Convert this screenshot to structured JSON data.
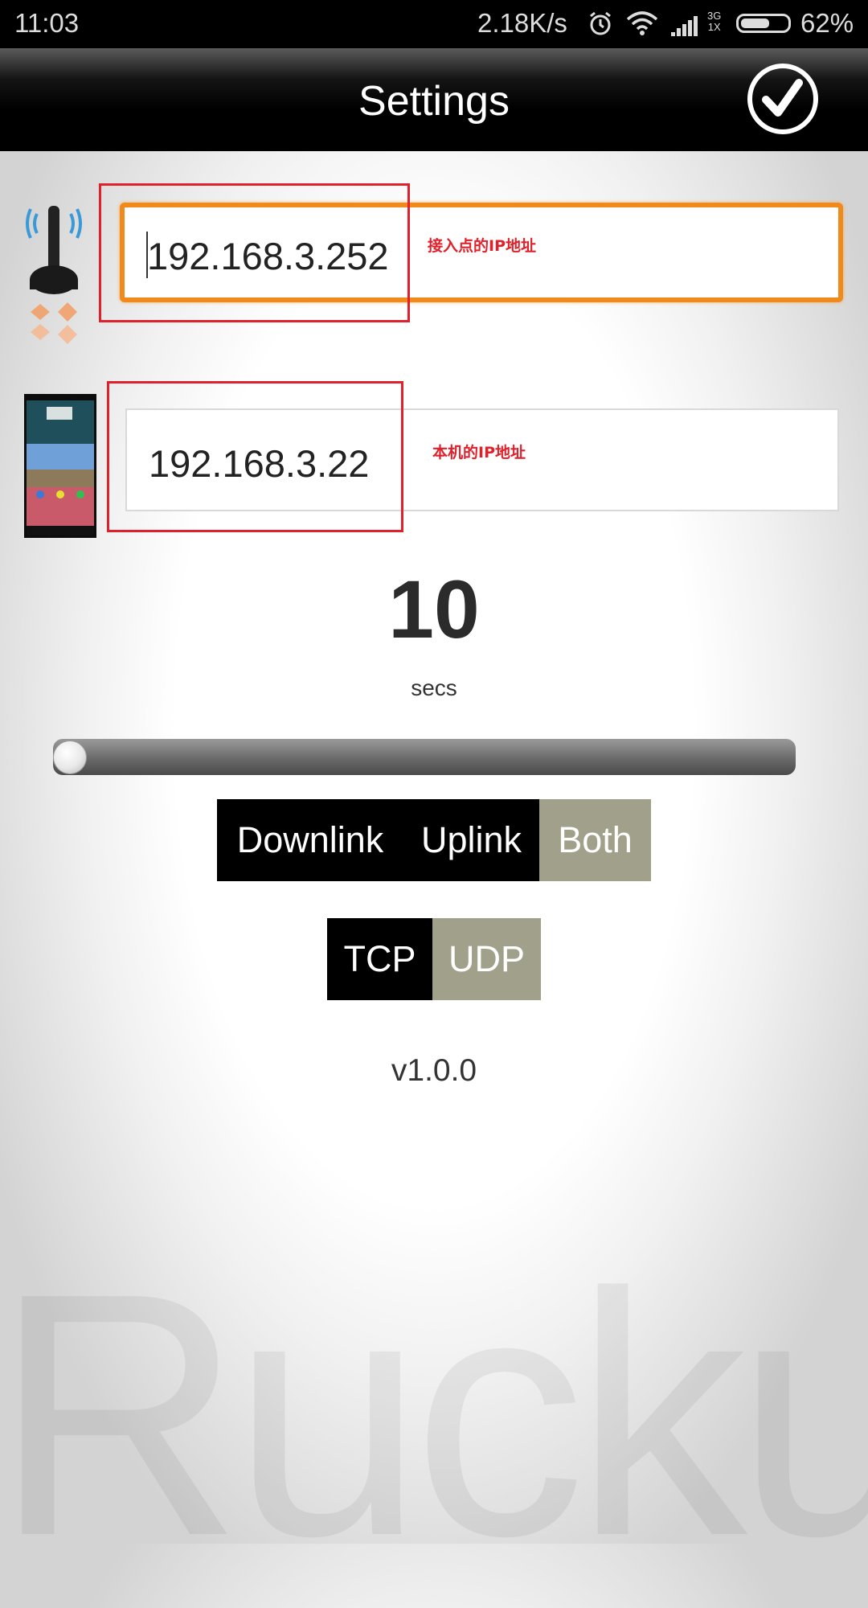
{
  "status_bar": {
    "time": "11:03",
    "net_speed": "2.18K/s",
    "network_top": "3G",
    "network_bottom": "1X",
    "battery_level": 0.62,
    "battery_text": "62%"
  },
  "action_bar": {
    "title": "Settings",
    "done_icon": "check-circle-icon"
  },
  "access_point": {
    "icon": "wireless-antenna-icon",
    "ip_value": "192.168.3.252",
    "annotation": "接入点的IP地址"
  },
  "local_device": {
    "icon": "phone-screenshot-icon",
    "ip_value": "192.168.3.22",
    "annotation": "本机的IP地址"
  },
  "duration": {
    "value": "10",
    "unit": "secs",
    "slider_fraction": 0.0
  },
  "direction": {
    "options": [
      "Downlink",
      "Uplink",
      "Both"
    ],
    "selected": "Both"
  },
  "protocol": {
    "options": [
      "TCP",
      "UDP"
    ],
    "selected": "UDP"
  },
  "version": "v1.0.0",
  "watermark": "Ruckus",
  "colors": {
    "accent_orange": "#f08a1c",
    "annotation_red": "#e0202a",
    "selected_segment": "#a1a08a"
  }
}
